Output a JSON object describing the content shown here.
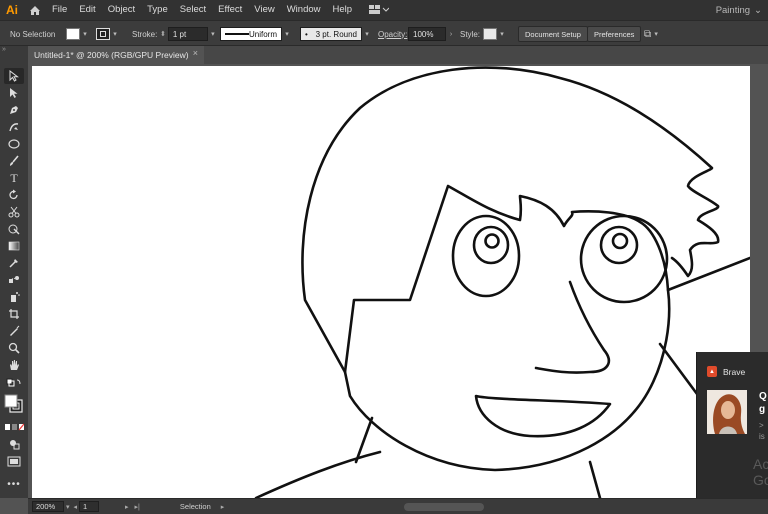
{
  "app": {
    "logo": "Ai"
  },
  "menu": [
    "File",
    "Edit",
    "Object",
    "Type",
    "Select",
    "Effect",
    "View",
    "Window",
    "Help"
  ],
  "workspace": {
    "label": "Painting"
  },
  "control_bar": {
    "selection_status": "No Selection",
    "stroke_label": "Stroke:",
    "stroke_weight": "1 pt",
    "profile": "Uniform",
    "brush": "3 pt. Round",
    "opacity_label": "Opacity:",
    "opacity_value": "100%",
    "style_label": "Style:",
    "document_setup": "Document Setup",
    "preferences": "Preferences"
  },
  "document": {
    "tab_title": "Untitled-1* @ 200% (RGB/GPU Preview)",
    "close_glyph": "×"
  },
  "status_bar": {
    "zoom": "200%",
    "artboard": "1",
    "tool": "Selection"
  },
  "notification": {
    "app": "Brave",
    "title_partial": "Q\ng",
    "body_partial": ">\nis",
    "watermark_partial": "Ac\nGo"
  },
  "colors": {
    "accent": "#ff9a00",
    "panel": "#3c3c3c",
    "canvas_bg": "#535353",
    "artboard": "#ffffff"
  },
  "icons": {
    "toolbar": [
      "selection-tool",
      "direct-selection-tool",
      "pen-tool",
      "curvature-tool",
      "ellipse-tool",
      "paintbrush-tool",
      "type-tool",
      "rotate-tool",
      "scissors-tool",
      "shape-builder-tool",
      "gradient-tool",
      "eyedropper-tool",
      "blend-tool",
      "symbol-sprayer-tool",
      "artboard-tool",
      "slice-tool",
      "zoom-tool",
      "hand-tool"
    ]
  }
}
